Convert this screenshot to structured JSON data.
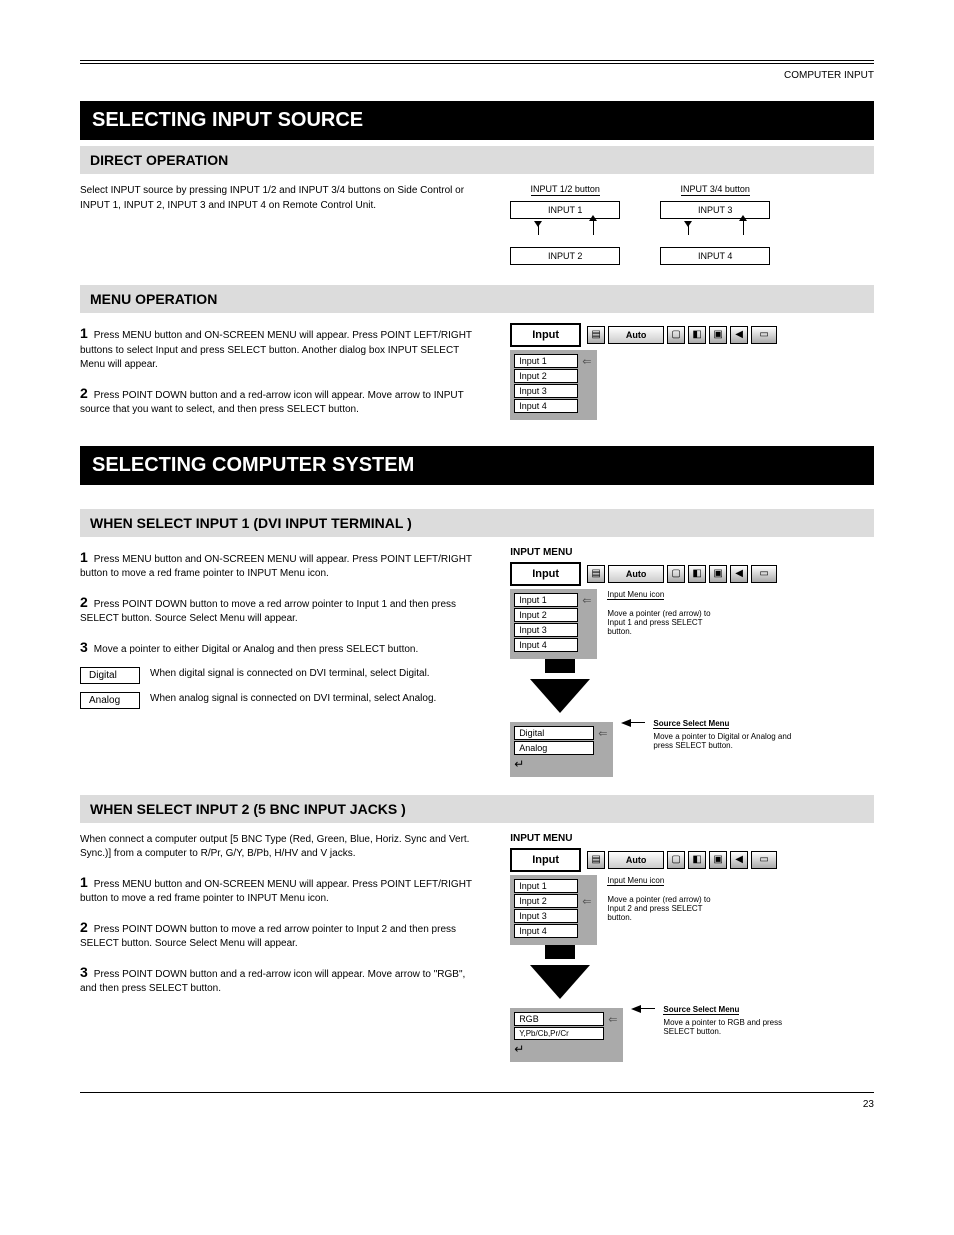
{
  "topNote": "COMPUTER INPUT",
  "section1": {
    "title": "SELECTING INPUT SOURCE",
    "directTitle": "DIRECT OPERATION",
    "directText": "Select INPUT source by pressing INPUT 1/2 and INPUT 3/4 buttons on Side Control or INPUT 1, INPUT 2, INPUT 3 and INPUT 4 on Remote Control Unit.",
    "diag1": {
      "header": "INPUT 1/2 button",
      "top": "INPUT 1",
      "bottom": "INPUT 2"
    },
    "diag2": {
      "header": "INPUT 3/4 button",
      "top": "INPUT 3",
      "bottom": "INPUT 4"
    },
    "menuTitle": "MENU OPERATION",
    "menuSteps": [
      "Press MENU button and ON-SCREEN MENU will appear. Press POINT LEFT/RIGHT buttons to select Input and press SELECT button. Another dialog box INPUT SELECT Menu will appear.",
      "Press POINT DOWN button and a red-arrow icon will appear. Move arrow to INPUT source that you want to select, and then press SELECT button."
    ]
  },
  "inputMenu": {
    "label": "Input",
    "autoLabel": "Auto",
    "items": [
      "Input 1",
      "Input 2",
      "Input 3",
      "Input 4"
    ]
  },
  "section2": {
    "title": "SELECTING COMPUTER SYSTEM",
    "input1Title": "WHEN SELECT INPUT 1 (DVI INPUT TERMINAL )",
    "input1Steps": [
      "Press MENU button and ON-SCREEN MENU will appear. Press POINT LEFT/RIGHT button to move a red frame pointer to INPUT Menu icon.",
      "Press POINT DOWN button to move a red arrow pointer to Input 1 and then press SELECT button. Source Select Menu will appear.",
      "Move a pointer to either Digital or Analog and then press SELECT button."
    ],
    "digitalLabel": "Digital",
    "digitalText": "When digital signal is connected on DVI terminal, select Digital.",
    "analogLabel": "Analog",
    "analogText": "When analog signal is connected on DVI terminal, select Analog.",
    "input2Title": "WHEN SELECT INPUT 2 (5 BNC INPUT JACKS )",
    "input2Intro": "When connect a computer output [5 BNC Type (Red, Green, Blue, Horiz. Sync and Vert. Sync.)] from a computer to R/Pr, G/Y, B/Pb, H/HV and V jacks.",
    "input2Steps": [
      "Press MENU button and ON-SCREEN MENU will appear. Press POINT LEFT/RIGHT button to move a red frame pointer to INPUT Menu icon.",
      "Press POINT DOWN button to move a red arrow pointer to Input 2 and then press SELECT button. Source Select Menu will appear.",
      "Press POINT DOWN button and a red-arrow icon will appear. Move arrow to \"RGB\", and then press SELECT button."
    ]
  },
  "uiLabels": {
    "inputMenuLabel": "INPUT MENU",
    "inputMenuIcon": "Input Menu icon",
    "movePointer1": "Move a pointer (red arrow) to Input 1 and press SELECT button.",
    "movePointer2": "Move a pointer (red arrow) to Input 2 and press SELECT button.",
    "sourceMenu": "Source Select Menu",
    "sourceMenu1Text": "Move a pointer to Digital or Analog and press SELECT button.",
    "sourceMenu2Text": "Move a pointer to RGB and press SELECT button.",
    "sourceMenu1Items": [
      "Digital",
      "Analog"
    ],
    "sourceMenu2Items": [
      "RGB",
      "Y,Pb/Cb,Pr/Cr"
    ]
  },
  "footer": {
    "page": "23"
  },
  "stepNums": {
    "s1": "1",
    "s2": "2",
    "s3": "3"
  }
}
